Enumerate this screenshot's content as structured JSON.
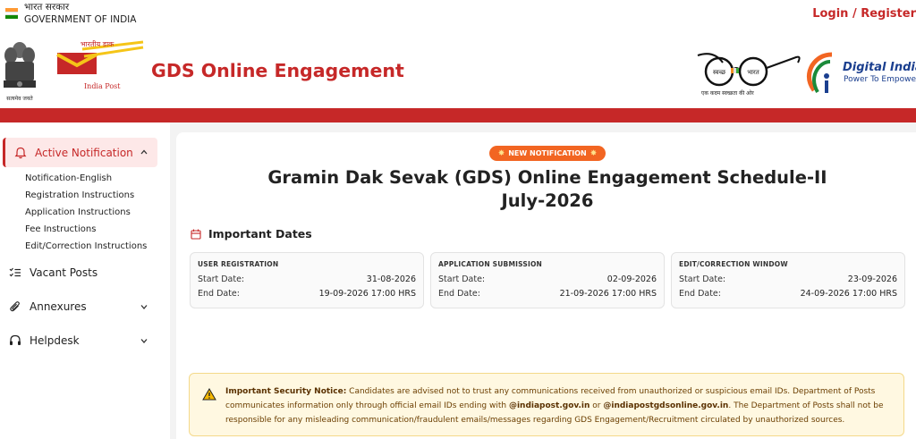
{
  "topbar": {
    "gov_hindi": "भारत सरकार",
    "gov_english": "GOVERNMENT OF INDIA",
    "login_label": "Login / Register"
  },
  "header": {
    "site_title": "GDS Online Engagement",
    "emblem_caption": "सत्यमेव जयते",
    "india_post_hindi": "भारतीय डाक",
    "india_post_label": "India Post",
    "swachh_left": "स्वच्छ",
    "swachh_right": "भारत",
    "swachh_caption": "एक कदम स्वच्छता की ओर",
    "digital_india": "Digital India",
    "digital_india_sub": "Power To Empower"
  },
  "sidebar": {
    "active": {
      "label": "Active Notification",
      "icon": "bell-icon"
    },
    "sub_items": [
      "Notification-English",
      "Registration Instructions",
      "Application Instructions",
      "Fee Instructions",
      "Edit/Correction Instructions"
    ],
    "items": [
      {
        "label": "Vacant Posts",
        "icon": "list-check-icon"
      },
      {
        "label": "Annexures",
        "icon": "paperclip-icon"
      },
      {
        "label": "Helpdesk",
        "icon": "headset-icon"
      }
    ]
  },
  "main": {
    "badge": "NEW NOTIFICATION",
    "title_line1": "Gramin Dak Sevak (GDS) Online Engagement Schedule-II",
    "title_line2": "July-2026",
    "important_dates_label": "Important Dates",
    "cards": [
      {
        "title": "USER REGISTRATION",
        "start_label": "Start Date:",
        "start": "31-08-2026",
        "end_label": "End Date:",
        "end": "19-09-2026 17:00 HRS"
      },
      {
        "title": "APPLICATION SUBMISSION",
        "start_label": "Start Date:",
        "start": "02-09-2026",
        "end_label": "End Date:",
        "end": "21-09-2026 17:00 HRS"
      },
      {
        "title": "EDIT/CORRECTION WINDOW",
        "start_label": "Start Date:",
        "start": "23-09-2026",
        "end_label": "End Date:",
        "end": "24-09-2026 17:00 HRS"
      }
    ],
    "notice": {
      "heading": "Important Security Notice:",
      "part1": " Candidates are advised not to trust any communications received from unauthorized or suspicious email IDs. Department of Posts communicates information only through official email IDs ending with ",
      "domain1": "@indiapost.gov.in",
      "or": " or ",
      "domain2": "@indiapostgdsonline.gov.in",
      "part2": ". The Department of Posts shall not be responsible for any misleading communication/fraudulent emails/messages regarding GDS Engagement/Recruitment circulated by unauthorized sources."
    }
  },
  "colors": {
    "brand_red": "#c62828",
    "badge_orange": "#f26522",
    "notice_bg": "#fff8e1"
  }
}
